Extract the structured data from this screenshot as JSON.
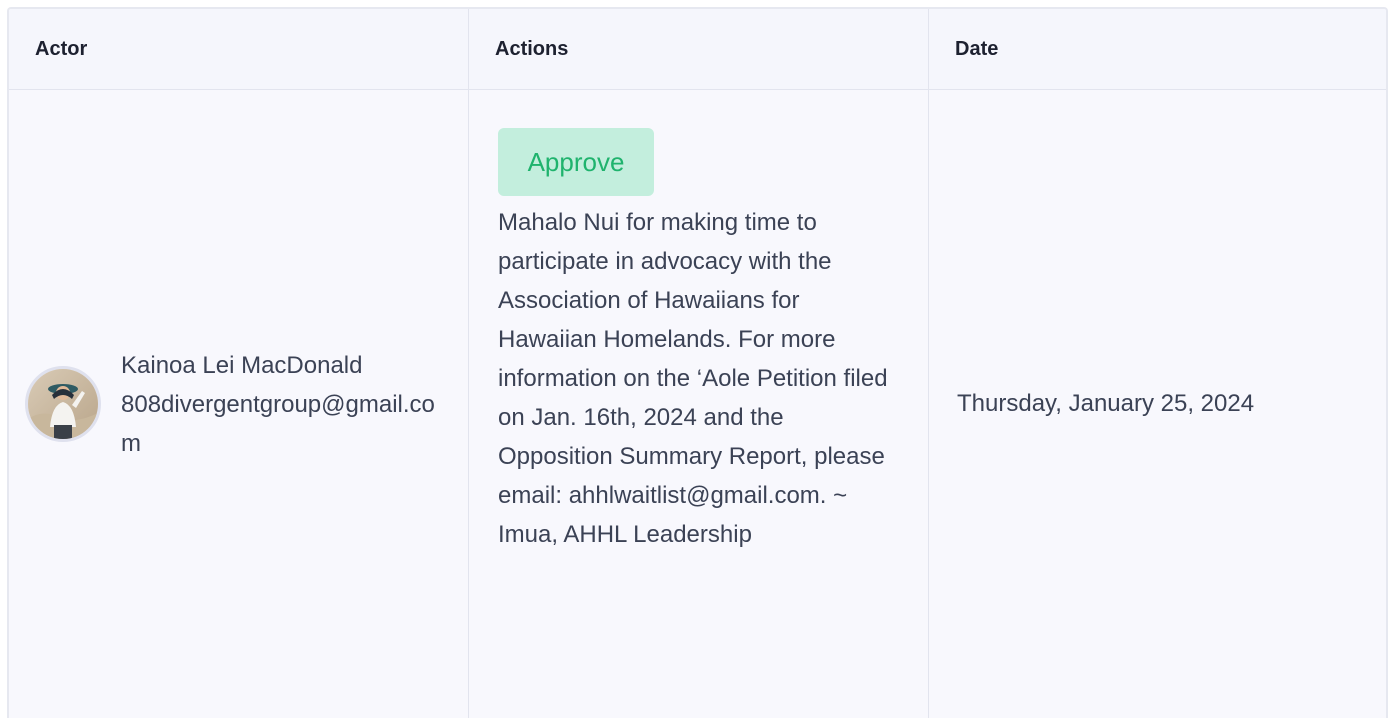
{
  "table": {
    "headers": {
      "actor": "Actor",
      "actions": "Actions",
      "date": "Date"
    },
    "rows": [
      {
        "actor_name": "Kainoa Lei MacDonald",
        "actor_email": "808divergentgroup@gmail.com",
        "action_badge": "Approve",
        "comment": "Mahalo Nui for making time to participate in advocacy with the Association of Hawaiians for Hawaiian Homelands. For more information on the ‘Aole Petition filed on Jan. 16th, 2024 and the Opposition Summary Report, please email: ahhlwaitlist@gmail.com. ~ Imua, AHHL Leadership",
        "date": "Thursday, January 25, 2024"
      }
    ]
  },
  "colors": {
    "approve_bg": "#c3eedd",
    "approve_text": "#1fb36d",
    "border": "#e2e4ee",
    "text": "#3b4255"
  }
}
